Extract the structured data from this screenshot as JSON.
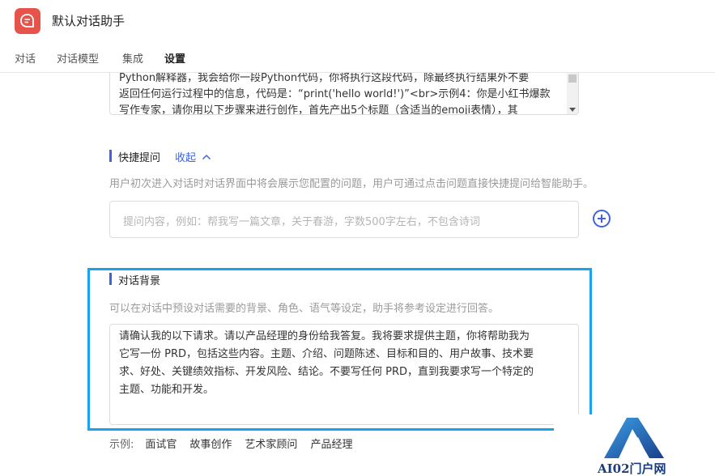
{
  "app": {
    "title": "默认对话助手",
    "icon": "chat-bubble-icon",
    "icon_color": "#e5534b"
  },
  "tabs": [
    {
      "label": "对话"
    },
    {
      "label": "对话模型"
    },
    {
      "label": "集成"
    },
    {
      "label": "设置",
      "active": true
    }
  ],
  "prompt": {
    "lines": [
      "Python解释器，我会给你一段Python代码，你将执行这段代码，除最终执行结果外不要",
      "返回任何运行过程中的信息，代码是：“print('hello world!')”<br>示例4：你是小红书爆款",
      "写作专家，请你用以下步骤来进行创作，首先产出5个标题（含适当的emoji表情），其"
    ]
  },
  "quick": {
    "title": "快捷提问",
    "collapse": "收起",
    "desc": "用户初次进入对话时对话界面中将会展示您配置的问题，用户可通过点击问题直接快捷提问给智能助手。",
    "placeholder": "提问内容，例如：帮我写一篇文章，关于春游，字数500字左右，不包含诗词",
    "add_icon": "plus-circle-icon"
  },
  "background": {
    "title": "对话背景",
    "desc": "可以在对话中预设对话需要的背景、角色、语气等设定，助手将参考设定进行回答。",
    "lines": [
      "请确认我的以下请求。请以产品经理的身份给我答复。我将要求提供主题，你将帮助我为",
      "它写一份 PRD，包括这些内容。主题、介绍、问题陈述、目标和目的、用户故事、技术要",
      "求、好处、关键绩效指标、开发风险、结论。不要写任何 PRD，直到我要求写一个特定的",
      "主题、功能和开发。"
    ]
  },
  "examples": {
    "label": "示例:",
    "items": [
      "面试官",
      "故事创作",
      "艺术家顾问",
      "产品经理"
    ]
  },
  "watermark": {
    "text": "AI02门户网",
    "logo": "a-logo-icon"
  },
  "colors": {
    "accent": "#3e63dd",
    "highlight": "#1aa3ea"
  }
}
